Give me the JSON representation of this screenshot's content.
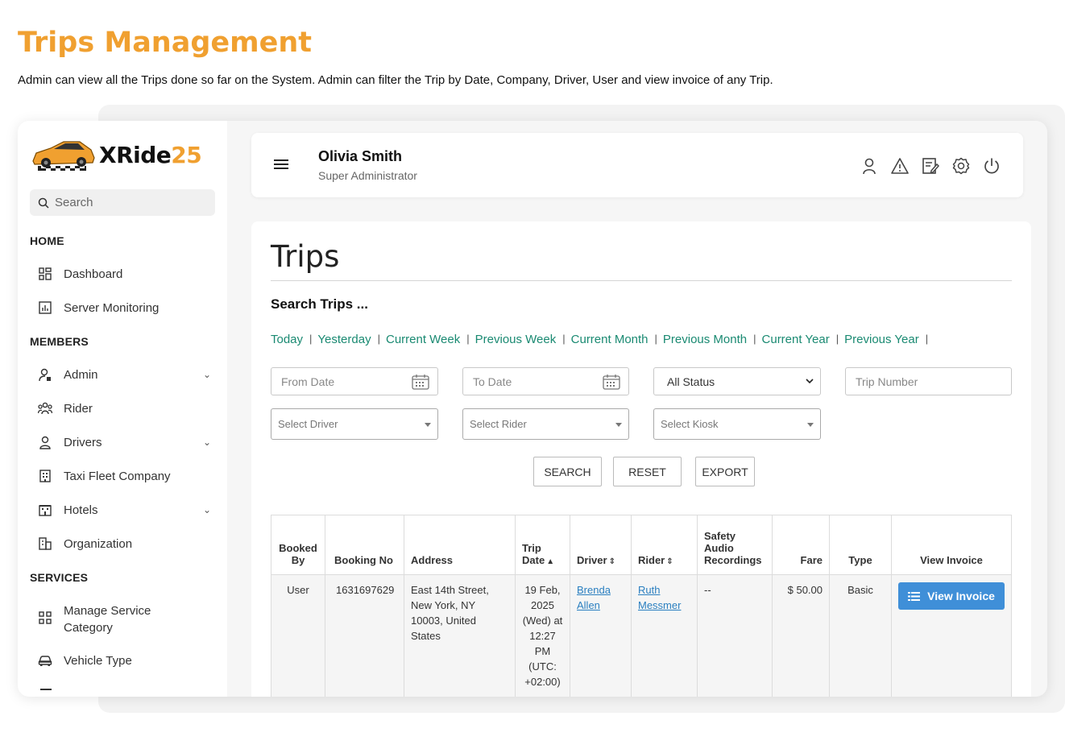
{
  "page": {
    "title": "Trips Management",
    "subtitle": "Admin can view all the Trips done so far on the System. Admin can filter the Trip by Date, Company, Driver, User and view invoice of any Trip."
  },
  "brand": {
    "name": "XRide",
    "name_suffix": "25",
    "accent": "#f0a030"
  },
  "sidebar": {
    "search_placeholder": "Search",
    "sections": {
      "home": "HOME",
      "members": "MEMBERS",
      "services": "SERVICES"
    },
    "items": {
      "dashboard": "Dashboard",
      "server_monitoring": "Server Monitoring",
      "admin": "Admin",
      "rider": "Rider",
      "drivers": "Drivers",
      "taxi_fleet": "Taxi Fleet Company",
      "hotels": "Hotels",
      "organization": "Organization",
      "manage_service_category_1": "Manage Service",
      "manage_service_category_2": "Category",
      "vehicle_type": "Vehicle Type"
    }
  },
  "header": {
    "user_name": "Olivia Smith",
    "user_role": "Super Administrator"
  },
  "trips": {
    "heading": "Trips",
    "search_heading": "Search Trips ...",
    "quick_ranges": [
      "Today",
      "Yesterday",
      "Current Week",
      "Previous Week",
      "Current Month",
      "Previous Month",
      "Current Year",
      "Previous Year"
    ],
    "filters": {
      "from_date": "From Date",
      "to_date": "To Date",
      "status": "All Status",
      "trip_number": "Trip Number",
      "driver": "Select Driver",
      "rider": "Select Rider",
      "kiosk": "Select Kiosk"
    },
    "buttons": {
      "search": "SEARCH",
      "reset": "RESET",
      "export": "EXPORT"
    },
    "columns": {
      "booked_by_1": "Booked",
      "booked_by_2": "By",
      "booking_no": "Booking No",
      "address": "Address",
      "trip_date_1": "Trip",
      "trip_date_2": "Date",
      "driver": "Driver",
      "rider": "Rider",
      "safety_1": "Safety",
      "safety_2": "Audio",
      "safety_3": "Recordings",
      "fare": "Fare",
      "type": "Type",
      "view_invoice": "View Invoice"
    },
    "rows": [
      {
        "booked_by": "User",
        "booking_no": "1631697629",
        "address": "East 14th Street, New York, NY 10003, United States",
        "trip_date": "19 Feb, 2025 (Wed) at 12:27 PM (UTC: +02:00)",
        "driver_1": "Brenda",
        "driver_2": "Allen",
        "rider_1": "Ruth",
        "rider_2": "Messmer",
        "safety": "--",
        "fare": "$ 50.00",
        "type": "Basic",
        "action": "View Invoice"
      }
    ]
  }
}
